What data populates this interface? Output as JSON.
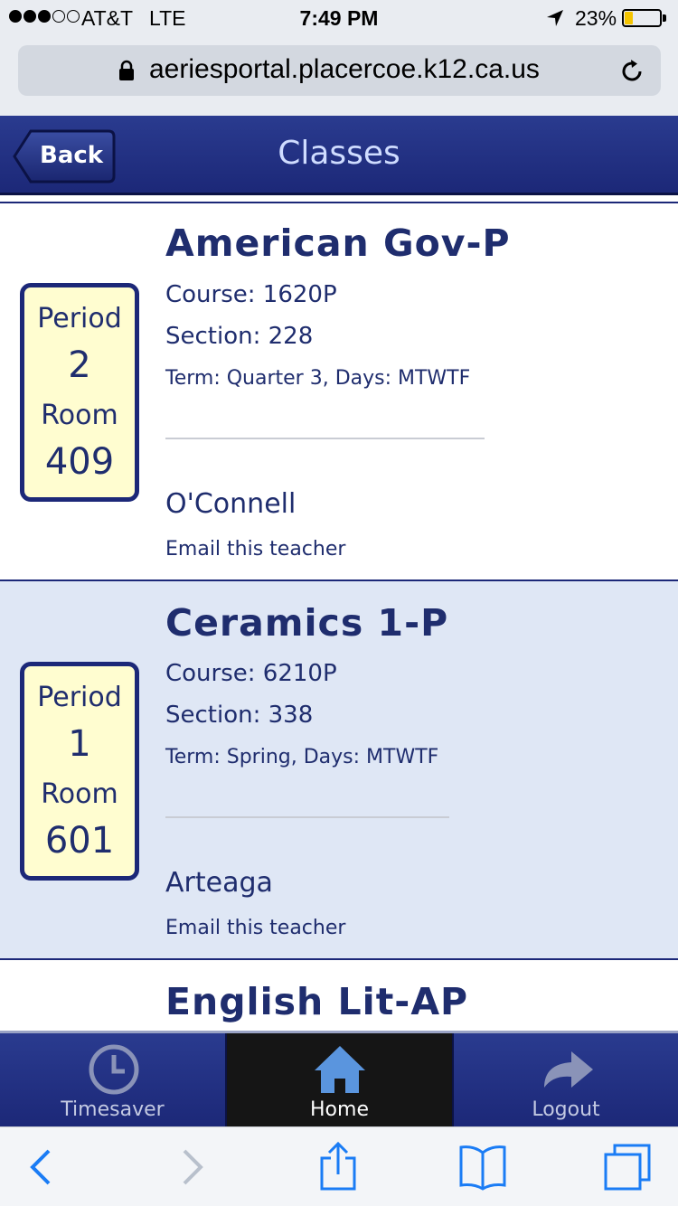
{
  "status_bar": {
    "carrier": "AT&T",
    "network": "LTE",
    "time": "7:49 PM",
    "battery_percent": "23%",
    "battery_level": 0.23,
    "signal_bars_filled": 3,
    "signal_bars_total": 5
  },
  "browser": {
    "url": "aeriesportal.placercoe.k12.ca.us"
  },
  "header": {
    "back_label": "Back",
    "title": "Classes"
  },
  "classes": [
    {
      "name": "American Gov-P",
      "period_label": "Period",
      "period": "2",
      "room_label": "Room",
      "room": "409",
      "course": "Course: 1620P",
      "section": "Section: 228",
      "term": "Term: Quarter 3, Days: MTWTF",
      "teacher": "O'Connell",
      "email_label": "Email this teacher"
    },
    {
      "name": "Ceramics 1-P",
      "period_label": "Period",
      "period": "1",
      "room_label": "Room",
      "room": "601",
      "course": "Course: 6210P",
      "section": "Section: 338",
      "term": "Term: Spring, Days: MTWTF",
      "teacher": "Arteaga",
      "email_label": "Email this teacher"
    },
    {
      "name": "English Lit-AP"
    }
  ],
  "app_nav": [
    {
      "label": "Timesaver",
      "icon": "clock-icon"
    },
    {
      "label": "Home",
      "icon": "home-icon",
      "active": true
    },
    {
      "label": "Logout",
      "icon": "logout-arrow-icon"
    }
  ],
  "safari_toolbar": [
    "back-icon",
    "forward-icon",
    "share-icon",
    "bookmarks-icon",
    "tabs-icon"
  ],
  "colors": {
    "navy": "#1c2878",
    "text_navy": "#1f2d6e",
    "period_box_bg": "#fffdd0",
    "alt_row_bg": "#dfe7f5",
    "ios_blue": "#1a7cf5"
  }
}
